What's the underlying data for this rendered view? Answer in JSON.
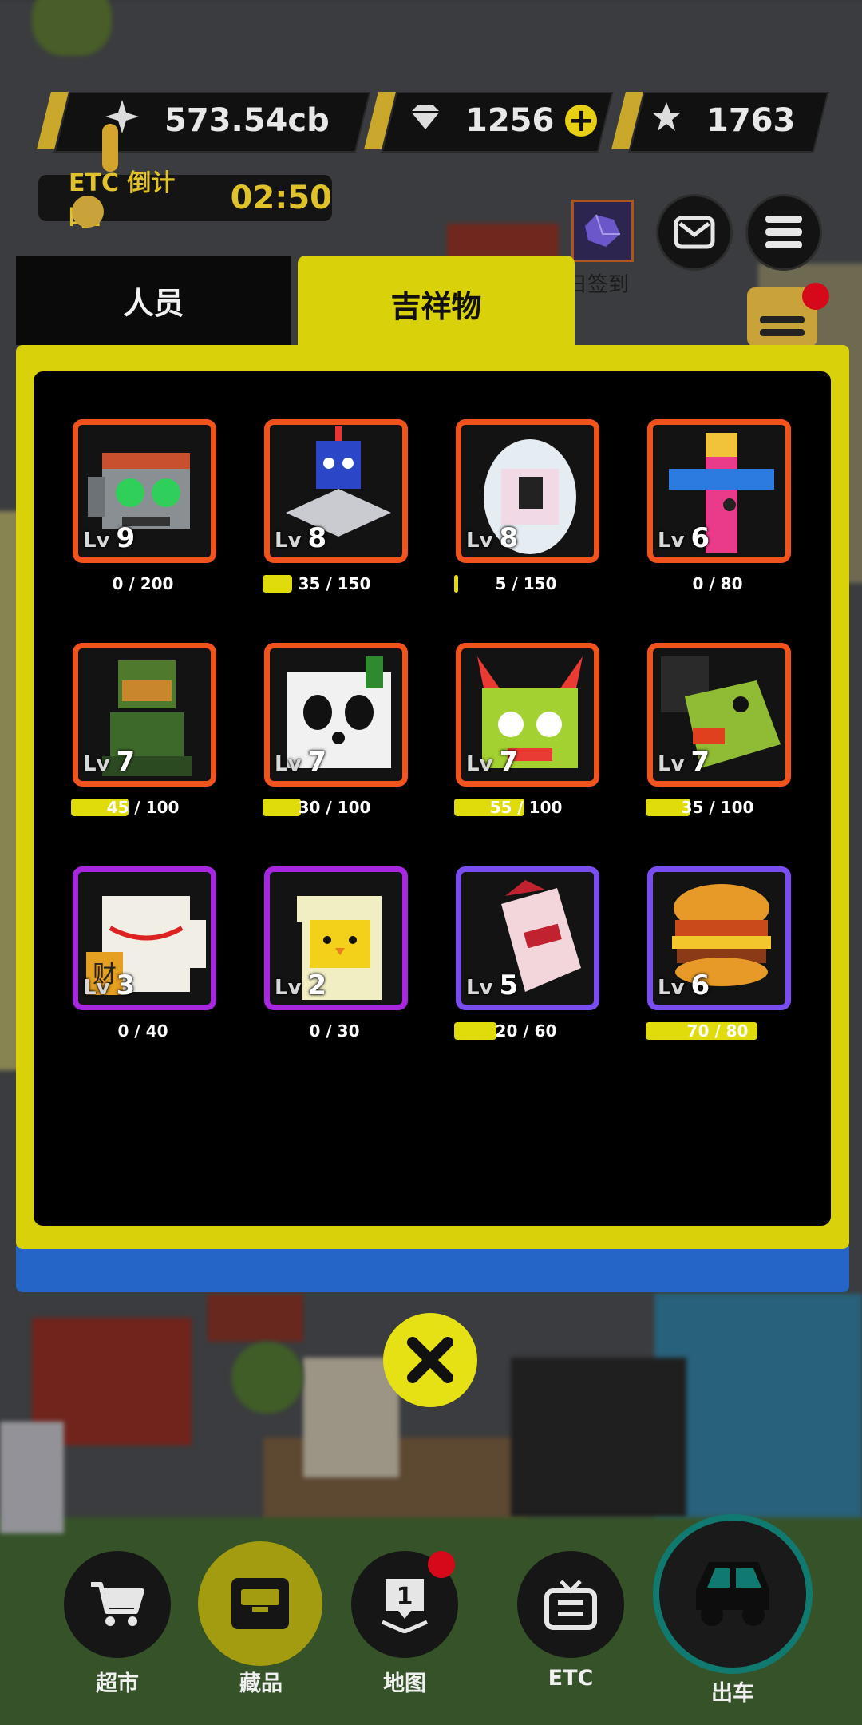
{
  "resources": {
    "currency": {
      "icon": "sparkle-icon",
      "value": "573.54cb"
    },
    "gems": {
      "icon": "diamond-icon",
      "value": "1256",
      "add_label": "+"
    },
    "stars": {
      "icon": "star-icon",
      "value": "1763"
    }
  },
  "etc_timer": {
    "label": "ETC 倒计时:",
    "value": "02:50"
  },
  "top_buttons": {
    "signin_label": "日签到"
  },
  "tabs": [
    {
      "label": "人员",
      "active": false
    },
    {
      "label": "吉祥物",
      "active": true
    }
  ],
  "mascots": [
    {
      "name": "robot-head",
      "level": "9",
      "progress_text": "0 / 200",
      "progress": 0.0,
      "rarity": "orange"
    },
    {
      "name": "ufo-robot",
      "level": "8",
      "progress_text": "35 / 150",
      "progress": 0.23,
      "rarity": "orange"
    },
    {
      "name": "tamagotchi",
      "level": "8",
      "progress_text": "5 / 150",
      "progress": 0.03,
      "rarity": "orange"
    },
    {
      "name": "totem-pole",
      "level": "6",
      "progress_text": "0 / 80",
      "progress": 0.0,
      "rarity": "orange"
    },
    {
      "name": "warrior-statue",
      "level": "7",
      "progress_text": "45 / 100",
      "progress": 0.45,
      "rarity": "orange"
    },
    {
      "name": "panda",
      "level": "7",
      "progress_text": "30 / 100",
      "progress": 0.3,
      "rarity": "orange"
    },
    {
      "name": "tiger-mask",
      "level": "7",
      "progress_text": "55 / 100",
      "progress": 0.55,
      "rarity": "orange"
    },
    {
      "name": "green-duck",
      "level": "7",
      "progress_text": "35 / 100",
      "progress": 0.35,
      "rarity": "orange"
    },
    {
      "name": "lucky-cat",
      "level": "3",
      "progress_text": "0 / 40",
      "progress": 0.0,
      "rarity": "purple"
    },
    {
      "name": "egg-chick",
      "level": "2",
      "progress_text": "0 / 30",
      "progress": 0.0,
      "rarity": "purple"
    },
    {
      "name": "milk-carton",
      "level": "5",
      "progress_text": "20 / 60",
      "progress": 0.33,
      "rarity": "violet"
    },
    {
      "name": "burger",
      "level": "6",
      "progress_text": "70 / 80",
      "progress": 0.875,
      "rarity": "violet"
    }
  ],
  "lv_prefix": "Lv",
  "bottom_nav": [
    {
      "label": "超市",
      "icon": "cart-icon"
    },
    {
      "label": "藏品",
      "icon": "collection-icon"
    },
    {
      "label": "地图",
      "icon": "map-pin-icon"
    },
    {
      "label": "ETC",
      "icon": "tv-icon"
    },
    {
      "label": "出车",
      "icon": "car-icon"
    }
  ],
  "colors": {
    "accent": "#d9d20b",
    "orange_frame": "#f0531c",
    "purple_frame": "#a726e0",
    "violet_frame": "#7a4df0"
  }
}
